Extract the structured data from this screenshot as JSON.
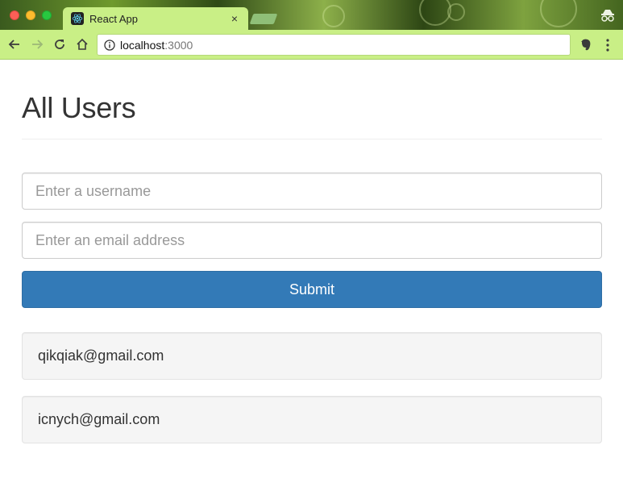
{
  "browser": {
    "tab_title": "React App",
    "tab_close": "×",
    "url_host": "localhost",
    "url_port": ":3000"
  },
  "page": {
    "title": "All Users",
    "form": {
      "username_placeholder": "Enter a username",
      "username_value": "",
      "email_placeholder": "Enter an email address",
      "email_value": "",
      "submit_label": "Submit"
    },
    "users": [
      {
        "email": "qikqiak@gmail.com"
      },
      {
        "email": "icnych@gmail.com"
      }
    ]
  },
  "colors": {
    "primary": "#337ab7",
    "chrome": "#c9ef86",
    "card": "#f5f5f5"
  }
}
